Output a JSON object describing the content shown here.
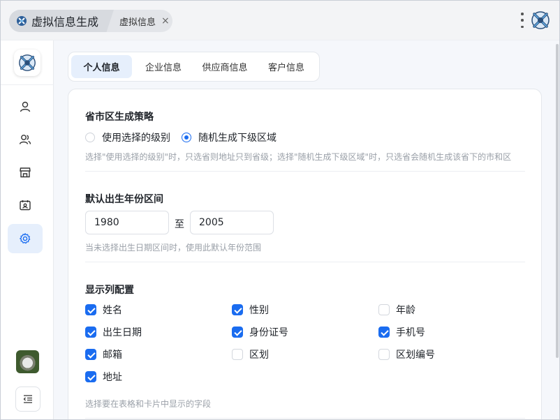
{
  "tabs": {
    "active_label": "虚拟信息生成",
    "second_label": "虚拟信息",
    "close_glyph": "×"
  },
  "content_tabs": [
    {
      "label": "个人信息"
    },
    {
      "label": "企业信息"
    },
    {
      "label": "供应商信息"
    },
    {
      "label": "客户信息"
    }
  ],
  "region_strategy": {
    "title": "省市区生成策略",
    "options": [
      {
        "label": "使用选择的级别",
        "selected": false
      },
      {
        "label": "随机生成下级区域",
        "selected": true
      }
    ],
    "hint": "选择\"使用选择的级别\"时，只选省则地址只到省级；选择\"随机生成下级区域\"时，只选省会随机生成该省下的市和区"
  },
  "birth_year": {
    "title": "默认出生年份区间",
    "from": "1980",
    "to_label": "至",
    "to": "2005",
    "hint": "当未选择出生日期区间时，使用此默认年份范围"
  },
  "columns": {
    "title": "显示列配置",
    "items": [
      {
        "label": "姓名",
        "checked": true
      },
      {
        "label": "性别",
        "checked": true
      },
      {
        "label": "年龄",
        "checked": false
      },
      {
        "label": "出生日期",
        "checked": true
      },
      {
        "label": "身份证号",
        "checked": true
      },
      {
        "label": "手机号",
        "checked": true
      },
      {
        "label": "邮箱",
        "checked": true
      },
      {
        "label": "区划",
        "checked": false
      },
      {
        "label": "区划编号",
        "checked": false
      },
      {
        "label": "地址",
        "checked": true
      }
    ],
    "hint": "选择要在表格和卡片中显示的字段"
  },
  "colors": {
    "accent": "#1a6cf0",
    "active_bg": "#e6effc"
  }
}
